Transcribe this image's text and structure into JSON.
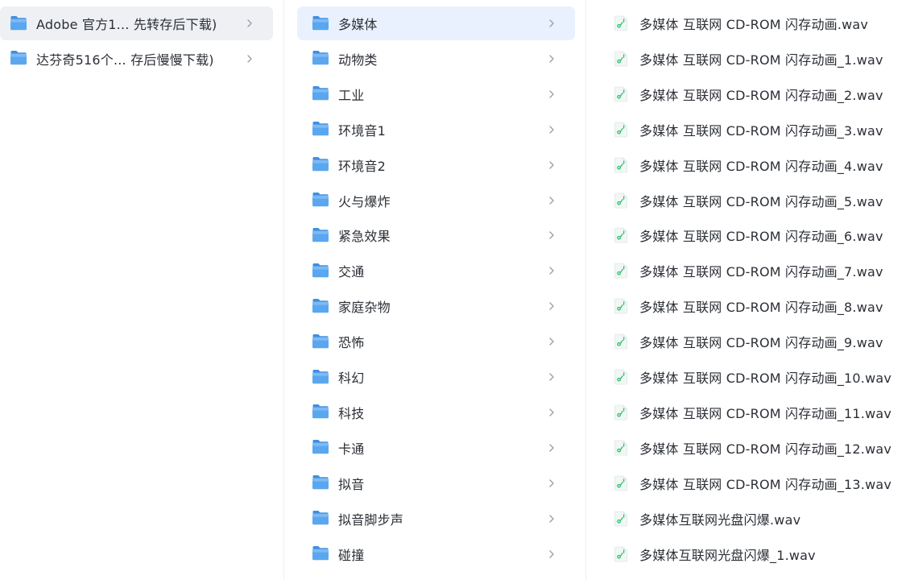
{
  "colors": {
    "folder": "#5aa7f0",
    "selected_row_grey": "#eef0f3",
    "selected_row_blue": "#eaf1fe",
    "audio_icon_accent": "#2fbf72"
  },
  "column1": {
    "items": [
      {
        "label": "Adobe 官方1...  先转存后下载)",
        "icon": "folder-icon",
        "selected": true
      },
      {
        "label": "达芬奇516个...  存后慢慢下载)",
        "icon": "folder-icon",
        "selected": false
      }
    ]
  },
  "column2": {
    "items": [
      {
        "label": "多媒体",
        "icon": "folder-icon",
        "selected": true
      },
      {
        "label": "动物类",
        "icon": "folder-icon"
      },
      {
        "label": "工业",
        "icon": "folder-icon"
      },
      {
        "label": "环境音1",
        "icon": "folder-icon"
      },
      {
        "label": "环境音2",
        "icon": "folder-icon"
      },
      {
        "label": "火与爆炸",
        "icon": "folder-icon"
      },
      {
        "label": "紧急效果",
        "icon": "folder-icon"
      },
      {
        "label": "交通",
        "icon": "folder-icon"
      },
      {
        "label": "家庭杂物",
        "icon": "folder-icon"
      },
      {
        "label": "恐怖",
        "icon": "folder-icon"
      },
      {
        "label": "科幻",
        "icon": "folder-icon"
      },
      {
        "label": "科技",
        "icon": "folder-icon"
      },
      {
        "label": "卡通",
        "icon": "folder-icon"
      },
      {
        "label": "拟音",
        "icon": "folder-icon"
      },
      {
        "label": "拟音脚步声",
        "icon": "folder-icon"
      },
      {
        "label": "碰撞",
        "icon": "folder-icon"
      }
    ]
  },
  "column3": {
    "items": [
      {
        "label": "多媒体 互联网 CD-ROM 闪存动画.wav",
        "icon": "audio-file-icon"
      },
      {
        "label": "多媒体 互联网 CD-ROM 闪存动画_1.wav",
        "icon": "audio-file-icon"
      },
      {
        "label": "多媒体 互联网 CD-ROM 闪存动画_2.wav",
        "icon": "audio-file-icon"
      },
      {
        "label": "多媒体 互联网 CD-ROM 闪存动画_3.wav",
        "icon": "audio-file-icon"
      },
      {
        "label": "多媒体 互联网 CD-ROM 闪存动画_4.wav",
        "icon": "audio-file-icon"
      },
      {
        "label": "多媒体 互联网 CD-ROM 闪存动画_5.wav",
        "icon": "audio-file-icon"
      },
      {
        "label": "多媒体 互联网 CD-ROM 闪存动画_6.wav",
        "icon": "audio-file-icon"
      },
      {
        "label": "多媒体 互联网 CD-ROM 闪存动画_7.wav",
        "icon": "audio-file-icon"
      },
      {
        "label": "多媒体 互联网 CD-ROM 闪存动画_8.wav",
        "icon": "audio-file-icon"
      },
      {
        "label": "多媒体 互联网 CD-ROM 闪存动画_9.wav",
        "icon": "audio-file-icon"
      },
      {
        "label": "多媒体 互联网 CD-ROM 闪存动画_10.wav",
        "icon": "audio-file-icon"
      },
      {
        "label": "多媒体 互联网 CD-ROM 闪存动画_11.wav",
        "icon": "audio-file-icon"
      },
      {
        "label": "多媒体 互联网 CD-ROM 闪存动画_12.wav",
        "icon": "audio-file-icon"
      },
      {
        "label": "多媒体 互联网 CD-ROM 闪存动画_13.wav",
        "icon": "audio-file-icon"
      },
      {
        "label": "多媒体互联网光盘闪爆.wav",
        "icon": "audio-file-icon"
      },
      {
        "label": "多媒体互联网光盘闪爆_1.wav",
        "icon": "audio-file-icon"
      }
    ]
  }
}
